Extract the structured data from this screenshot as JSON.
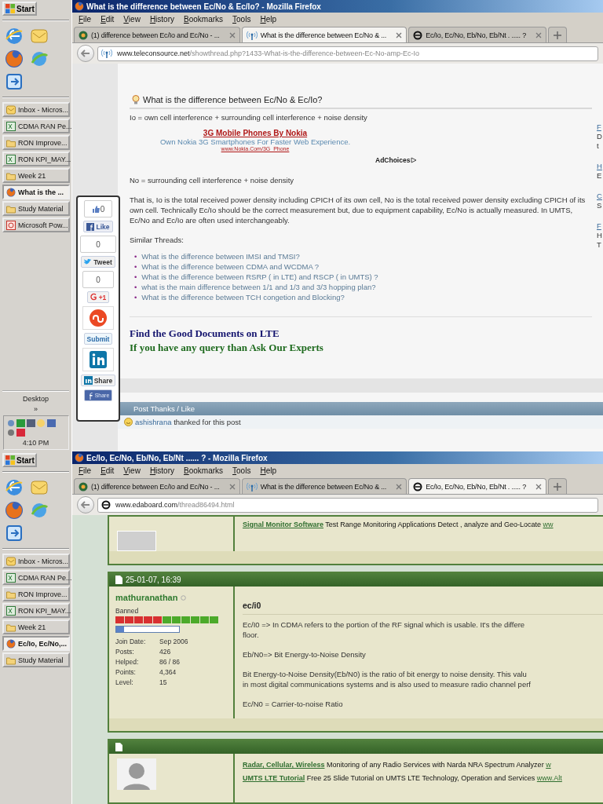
{
  "screens": [
    {
      "kind": "thread",
      "taskbar": {
        "start": "Start",
        "tasks": [
          {
            "kind": "outlook",
            "label": "Inbox - Micros...",
            "selected": false
          },
          {
            "kind": "excel",
            "label": "CDMA RAN Pe...",
            "selected": false
          },
          {
            "kind": "folder",
            "label": "RON Improve...",
            "selected": false
          },
          {
            "kind": "excel",
            "label": "RON KPI_MAY...",
            "selected": false
          },
          {
            "kind": "folder",
            "label": "Week 21",
            "selected": false
          },
          {
            "kind": "firefox",
            "label": "What is the ...",
            "selected": true
          },
          {
            "kind": "folder",
            "label": "Study Material",
            "selected": false
          },
          {
            "kind": "powerpoint",
            "label": "Microsoft Pow...",
            "selected": false
          }
        ],
        "desktop": "Desktop",
        "more": "»",
        "clock": "4:10 PM"
      },
      "window": {
        "title": "What is the difference between Ec/No & Ec/Io? - Mozilla Firefox",
        "menu": [
          "File",
          "Edit",
          "View",
          "History",
          "Bookmarks",
          "Tools",
          "Help"
        ],
        "tabs": [
          {
            "kind": "bing",
            "label": "(1) difference between Ec/Io and Ec/No - ...",
            "selected": false
          },
          {
            "kind": "signal",
            "label": "What is the difference between Ec/No & ...",
            "selected": true
          },
          {
            "kind": "e",
            "label": "Ec/Io, Ec/No, Eb/No, Eb/Nt . ..... ?",
            "selected": false
          }
        ],
        "address": {
          "kind": "signal",
          "domain": "www.teleconsource.net",
          "path": "/showthread.php?1433-What-is-the-difference-between-Ec-No-amp-Ec-Io"
        }
      },
      "page": {
        "share": [
          {
            "kind": "like",
            "count": "0",
            "label": "Like"
          },
          {
            "kind": "tweet",
            "count": "0",
            "label": "Tweet"
          },
          {
            "kind": "plusone",
            "count": "0",
            "label": "+1"
          },
          {
            "kind": "submit",
            "label": "Submit"
          },
          {
            "kind": "linkedin",
            "label": "Share"
          },
          {
            "kind": "fbshare",
            "label": "Share"
          }
        ],
        "post_title": "What is the difference between Ec/No & Ec/Io?",
        "intro": "Io = own cell interference + surrounding cell interference + noise density",
        "ad": {
          "headline": "3G Mobile Phones By Nokia",
          "text": "Own Nokia 3G Smartphones For Faster Web Experience.",
          "url": "www.Nokia.Com/3G_Phone",
          "choices": "AdChoices"
        },
        "paragraphs": [
          "No = surrounding cell interference + noise density",
          "That is, Io is the total received power density including CPICH of its own cell, No is the total received power density excluding CPICH of its own cell. Technically Ec/Io should be the correct measurement but, due to equipment capability, Ec/No is actually measured. In UMTS, Ec/No and Ec/Io are often used interchangeably."
        ],
        "similar_label": "Similar Threads:",
        "bullet": "•",
        "similar": [
          "What is the difference between IMSI and TMSI?",
          "What is the difference between CDMA and WCDMA ?",
          "What is the difference between RSRP ( in LTE) and RSCP ( in UMTS) ?",
          "what is the main difference between 1/1 and 1/3 and 3/3 hopping plan?",
          "What is the difference between TCH congetion and Blocking?"
        ],
        "promos": [
          {
            "text": "Find the Good Documents on LTE",
            "color": "#14146e"
          },
          {
            "text": "If you have any query than Ask Our Experts",
            "color": "#1e6a1e"
          }
        ],
        "thanks_bar": "Post Thanks / Like",
        "thanked": {
          "user": "ashishrana",
          "text": "thanked for this post"
        },
        "sidebar": [
          {
            "link": "F",
            "lines": [
              "D",
              "t"
            ]
          },
          {
            "link": "H",
            "lines": [
              "E"
            ]
          },
          {
            "link": "C",
            "lines": [
              "S"
            ]
          },
          {
            "link": "F",
            "lines": [
              "H",
              "T"
            ]
          }
        ]
      }
    },
    {
      "kind": "forum",
      "taskbar": {
        "start": "Start",
        "tasks": [
          {
            "kind": "outlook",
            "label": "Inbox - Micros...",
            "selected": false
          },
          {
            "kind": "excel",
            "label": "CDMA RAN Pe...",
            "selected": false
          },
          {
            "kind": "folder",
            "label": "RON Improve...",
            "selected": false
          },
          {
            "kind": "excel",
            "label": "RON KPI_MAY...",
            "selected": false
          },
          {
            "kind": "folder",
            "label": "Week 21",
            "selected": false
          },
          {
            "kind": "firefox",
            "label": "Ec/Io, Ec/No,...",
            "selected": true
          },
          {
            "kind": "folder",
            "label": "Study Material",
            "selected": false
          }
        ]
      },
      "window": {
        "title": "Ec/Io, Ec/No, Eb/No, Eb/Nt ...... ? - Mozilla Firefox",
        "menu": [
          "File",
          "Edit",
          "View",
          "History",
          "Bookmarks",
          "Tools",
          "Help"
        ],
        "tabs": [
          {
            "kind": "bing",
            "label": "(1) difference between Ec/Io and Ec/No - ...",
            "selected": false
          },
          {
            "kind": "signal",
            "label": "What is the difference between Ec/No & ...",
            "selected": false
          },
          {
            "kind": "e",
            "label": "Ec/Io, Ec/No, Eb/No, Eb/Nt . ..... ?",
            "selected": true
          }
        ],
        "address": {
          "kind": "e",
          "domain": "www.edaboard.com",
          "path": "/thread86494.html"
        }
      },
      "page": {
        "top_ad": {
          "link": "Signal Monitor Software",
          "text": "Test Range Monitoring Applications Detect , analyze and Geo-Locate",
          "url": "ww"
        },
        "post": {
          "date": "25-01-07, 16:39",
          "user": "mathuranathan",
          "online": false,
          "rank": "Banned",
          "progress": {
            "level": 0.12
          },
          "stats": [
            {
              "label": "Join Date:",
              "value": "Sep 2006"
            },
            {
              "label": "Posts:",
              "value": "426"
            },
            {
              "label": "Helped:",
              "value": "86 / 86"
            },
            {
              "label": "Points:",
              "value": "4,364"
            },
            {
              "label": "Level:",
              "value": "15"
            }
          ],
          "title": "ec/i0",
          "paragraphs": [
            [
              "Ec/I0 => In CDMA refers to the portion of the RF signal which is usable. It's the differe",
              "floor."
            ],
            [
              "Eb/N0=> Bit Energy-to-Noise Density"
            ],
            [
              "Bit Energy-to-Noise Density(Eb/N0) is the ratio of bit energy to noise density. This valu",
              "in most digital communications systems and is also used to measure radio channel perf"
            ],
            [
              "Ec/N0 = Carrier-to-noise Ratio"
            ]
          ]
        },
        "next_ads": [
          {
            "link": "Radar, Cellular, Wireless",
            "text": "Monitoring of any Radio Services with Narda NRA Spectrum Analyzer",
            "url": "w"
          },
          {
            "link": "UMTS LTE Tutorial",
            "text": "Free 25 Slide Tutorial on UMTS LTE Technology, Operation and Services",
            "url": "www.Alt"
          }
        ]
      }
    }
  ]
}
